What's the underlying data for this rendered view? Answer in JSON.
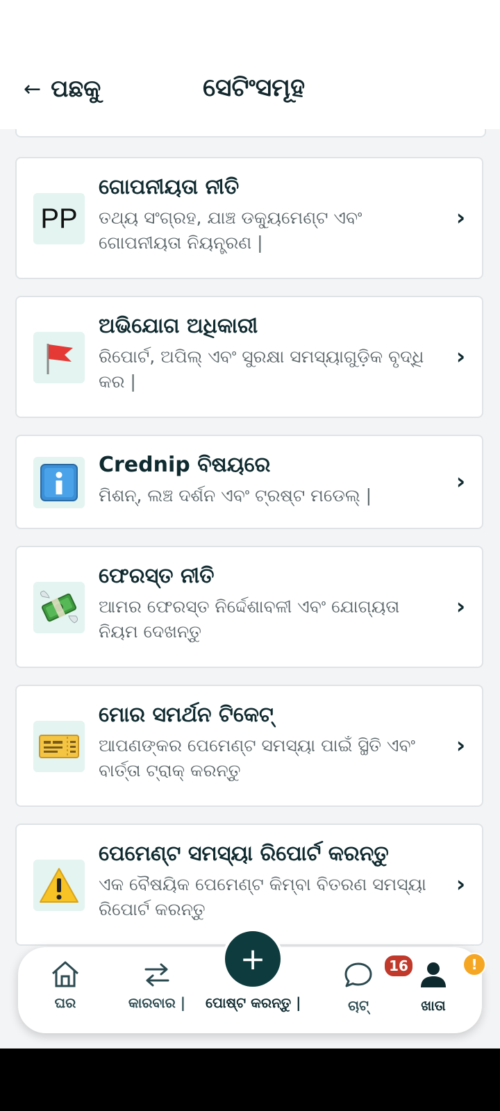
{
  "header": {
    "back_arrow": "←",
    "back_label": "ପଛକୁ",
    "title": "ସେଟିଂସମୂହ"
  },
  "settings_items": [
    {
      "icon": "pp-text-icon",
      "icon_text": "PP",
      "title": "ଗୋପନୀୟତା ନୀତି",
      "description": "ତଥ୍ୟ ସଂଗ୍ରହ, ଯାଞ୍ଚ ଡକ୍ୟୁମେଣ୍ଟ ଏବଂ ଗୋପନୀୟତା ନିୟନ୍ତ୍ରଣ |"
    },
    {
      "icon": "red-flag-icon",
      "title": "ଅଭିଯୋଗ ଅଧିକାରୀ",
      "description": "ରିପୋର୍ଟ, ଅପିଲ୍ ଏବଂ ସୁରକ୍ଷା ସମସ୍ୟାଗୁଡ଼ିକ ବୃଦ୍ଧି କର |"
    },
    {
      "icon": "info-icon",
      "title": "Crednip ବିଷୟରେ",
      "description": "ମିଶନ୍, ଲଞ୍ଚ ଦର୍ଶନ ଏବଂ ଟ୍ରଷ୍ଟ ମଡେଲ୍ |"
    },
    {
      "icon": "money-wings-icon",
      "title": "ଫେରସ୍ତ ନୀତି",
      "description": "ଆମର ଫେରସ୍ତ ନିର୍ଦ୍ଦେଶାବଳୀ ଏବଂ ଯୋଗ୍ୟତା ନିୟମ ଦେଖନ୍ତୁ"
    },
    {
      "icon": "ticket-icon",
      "title": "ମୋର ସମର୍ଥନ ଟିକେଟ୍",
      "description": "ଆପଣଙ୍କର ପେମେଣ୍ଟ ସମସ୍ୟା ପାଇଁ ସ୍ଥିତି ଏବଂ ବାର୍ତ୍ତା ଟ୍ରାକ୍ କରନ୍ତୁ"
    },
    {
      "icon": "warning-icon",
      "title": "ପେମେଣ୍ଟ ସମସ୍ୟା ରିପୋର୍ଟ କରନ୍ତୁ",
      "description": "ଏକ ବୈଷୟିକ ପେମେଣ୍ଟ କିମ୍ବା ବିତରଣ ସମସ୍ୟା ରିପୋର୍ଟ କରନ୍ତୁ"
    }
  ],
  "chevron": "›",
  "bottom_nav": {
    "home": "ଘର",
    "business": "କାରବାର |",
    "post": "ପୋଷ୍ଟ କରନ୍ତୁ |",
    "post_symbol": "+",
    "chat": "ଚାଟ୍",
    "chat_badge": "16",
    "account": "ଖାତା",
    "account_badge": "!"
  }
}
